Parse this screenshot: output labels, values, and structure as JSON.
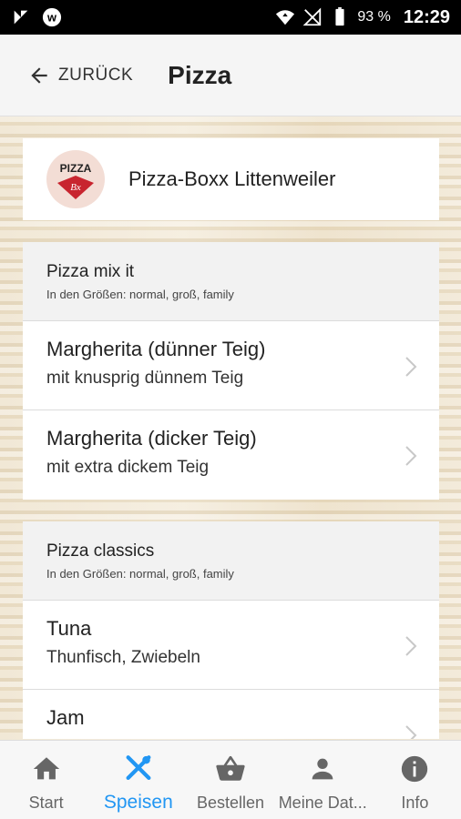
{
  "status_bar": {
    "battery": "93 %",
    "time": "12:29"
  },
  "app_bar": {
    "back_label": "ZURÜCK",
    "title": "Pizza"
  },
  "restaurant": {
    "name": "Pizza-Boxx Littenweiler",
    "logo_text": "PIZZA"
  },
  "sections": [
    {
      "title": "Pizza mix it",
      "subtitle": "In den Größen: normal, groß, family",
      "items": [
        {
          "name": "Margherita (dünner Teig)",
          "desc": "mit knusprig dünnem Teig"
        },
        {
          "name": "Margherita (dicker Teig)",
          "desc": "mit extra dickem Teig"
        }
      ]
    },
    {
      "title": "Pizza classics",
      "subtitle": "In den Größen: normal, groß, family",
      "items": [
        {
          "name": "Tuna",
          "desc": "Thunfisch, Zwiebeln"
        },
        {
          "name": "Jam",
          "desc": ""
        }
      ]
    }
  ],
  "bottom_nav": {
    "start": "Start",
    "speisen": "Speisen",
    "bestellen": "Bestellen",
    "meine_daten": "Meine Dat...",
    "info": "Info",
    "active_color": "#2196f3"
  }
}
